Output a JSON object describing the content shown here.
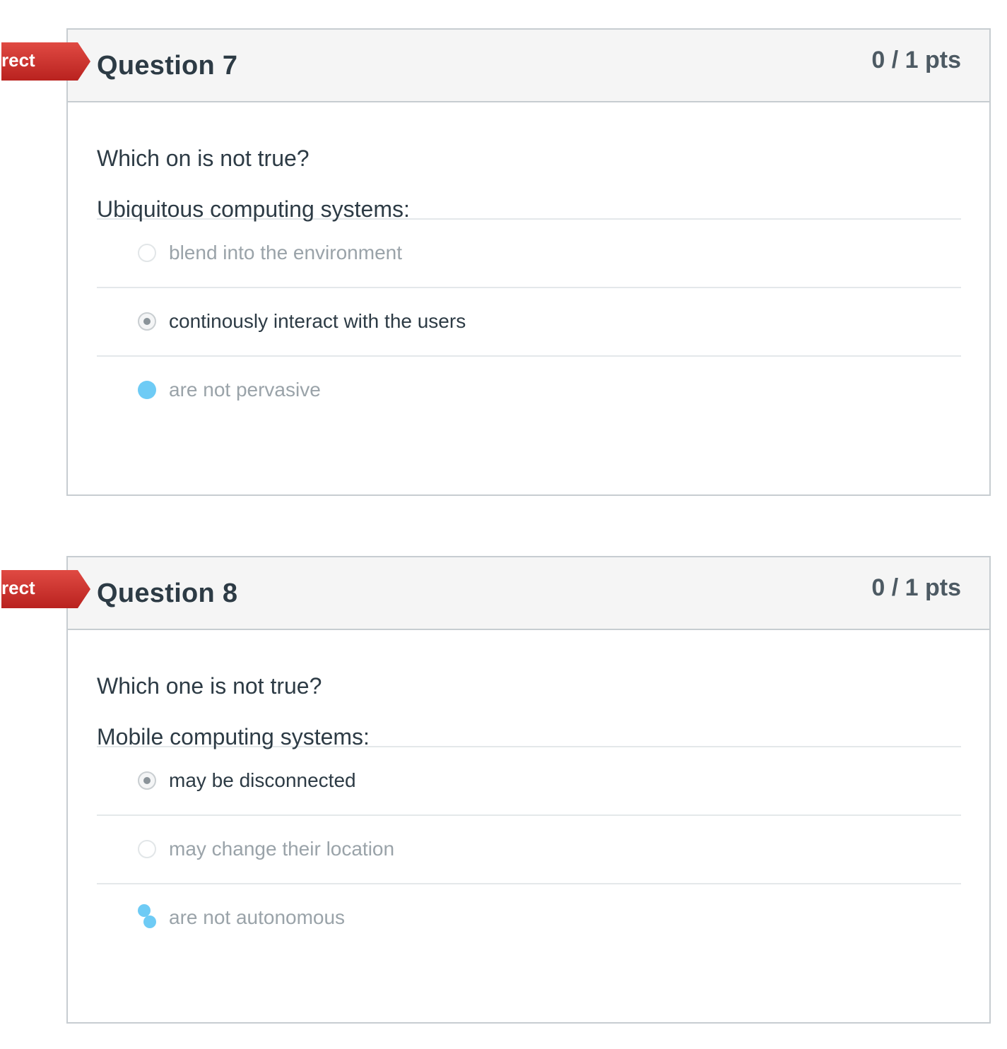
{
  "questions": [
    {
      "title": "Question 7",
      "points": "0 / 1 pts",
      "banner": "rect",
      "text": [
        "Which on is not true?",
        "Ubiquitous computing systems:"
      ],
      "answers": [
        {
          "label": "blend into the environment",
          "state": "unselected"
        },
        {
          "label": "continously interact with the users",
          "state": "selected"
        },
        {
          "label": "are not pervasive",
          "state": "highlighted"
        }
      ]
    },
    {
      "title": "Question 8",
      "points": "0 / 1 pts",
      "banner": "rect",
      "text": [
        "Which one is not true?",
        "Mobile computing systems:"
      ],
      "answers": [
        {
          "label": "may be disconnected",
          "state": "selected"
        },
        {
          "label": "may change their location",
          "state": "unselected"
        },
        {
          "label": "are not autonomous",
          "state": "highlighted"
        }
      ]
    }
  ],
  "colors": {
    "banner_red": "#d0312d",
    "border": "#c7cdd1",
    "header_bg": "#f5f5f5",
    "highlight_blue": "#6ecbf5",
    "text_dark": "#2d3b45",
    "text_dim": "#9aa3a9"
  }
}
